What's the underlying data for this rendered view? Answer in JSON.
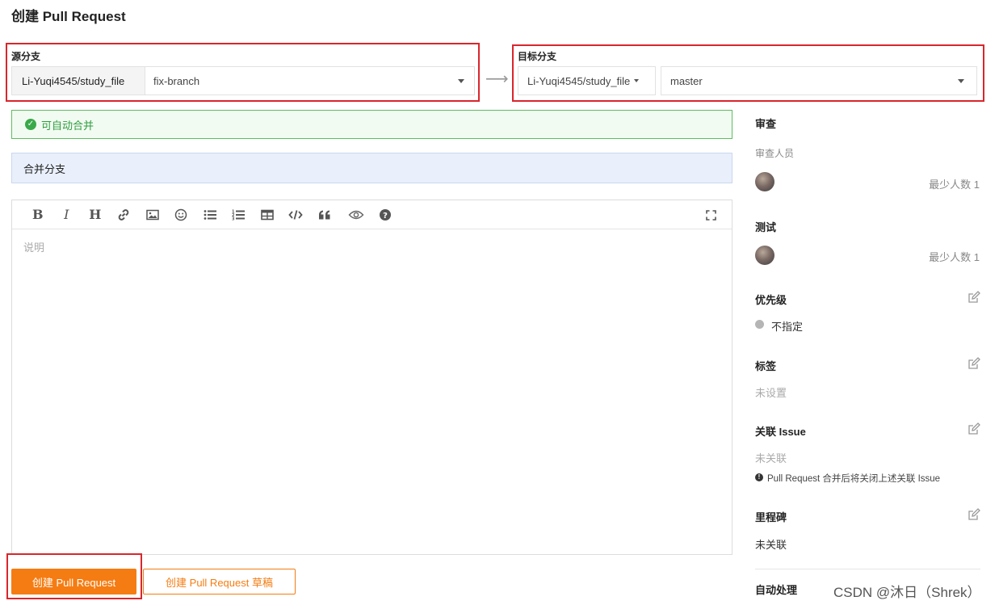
{
  "page_title": "创建 Pull Request",
  "source": {
    "label": "源分支",
    "repo": "Li-Yuqi4545/study_file",
    "branch": "fix-branch"
  },
  "target": {
    "label": "目标分支",
    "repo": "Li-Yuqi4545/study_file",
    "branch": "master"
  },
  "merge_status": "可自动合并",
  "pr_title": "合并分支",
  "editor": {
    "placeholder": "说明",
    "toolbar_icons": [
      "bold-icon",
      "italic-icon",
      "heading-icon",
      "link-icon",
      "image-icon",
      "emoji-icon",
      "bullet-list-icon",
      "numbered-list-icon",
      "table-icon",
      "code-icon",
      "quote-icon",
      "preview-icon",
      "help-icon",
      "fullscreen-icon"
    ]
  },
  "buttons": {
    "create": "创建 Pull Request",
    "create_draft": "创建 Pull Request 草稿"
  },
  "sidebar": {
    "review": {
      "title": "审查",
      "sub": "审查人员",
      "min": "最少人数 1"
    },
    "test": {
      "title": "测试",
      "min": "最少人数 1"
    },
    "priority": {
      "title": "优先级",
      "value": "不指定"
    },
    "labels": {
      "title": "标签",
      "value": "未设置"
    },
    "issue": {
      "title": "关联 Issue",
      "value": "未关联",
      "note": "Pull Request 合并后将关闭上述关联 Issue"
    },
    "milestone": {
      "title": "里程碑",
      "value": "未关联"
    },
    "auto": {
      "title": "自动处理"
    }
  },
  "watermark": "CSDN @沐日（Shrek）",
  "colors": {
    "accent": "#f57c12",
    "highlight_box": "#d9262c",
    "success": "#3aa94a"
  }
}
